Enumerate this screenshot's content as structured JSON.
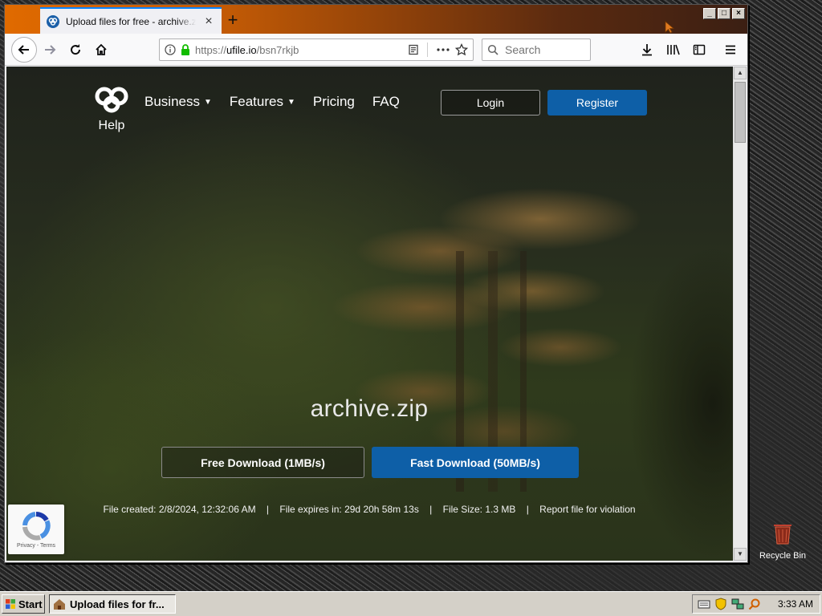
{
  "browser": {
    "tab_title": "Upload files for free - archive.zip - ufile.io",
    "tab_close": "×",
    "new_tab": "+",
    "url_proto": "https://",
    "url_host": "ufile.io",
    "url_path": "/bsn7rkjb",
    "search_placeholder": "Search",
    "window_controls": [
      "_",
      "□",
      "×"
    ]
  },
  "site": {
    "logo_label": "Help",
    "nav": [
      {
        "label": "Business",
        "has_menu": true
      },
      {
        "label": "Features",
        "has_menu": true
      },
      {
        "label": "Pricing",
        "has_menu": false
      },
      {
        "label": "FAQ",
        "has_menu": false
      }
    ],
    "login_label": "Login",
    "register_label": "Register",
    "filename": "archive.zip",
    "free_download_label": "Free Download (1MB/s)",
    "fast_download_label": "Fast Download (50MB/s)",
    "info": {
      "created": "File created: 2/8/2024, 12:32:06 AM",
      "expires": "File expires in: 29d 20h 58m 13s",
      "size": "File Size: 1.3 MB",
      "separator": "|",
      "report": "Report file for violation"
    },
    "recaptcha_terms": "Privacy - Terms"
  },
  "desktop": {
    "recycle_bin_label": "Recycle Bin"
  },
  "taskbar": {
    "start_label": "Start",
    "task_label": "Upload files for fr...",
    "clock": "3:33 AM"
  },
  "colors": {
    "accent_blue": "#0e5fa7",
    "tab_accent": "#0a84ff",
    "lock_green": "#12bc00"
  }
}
